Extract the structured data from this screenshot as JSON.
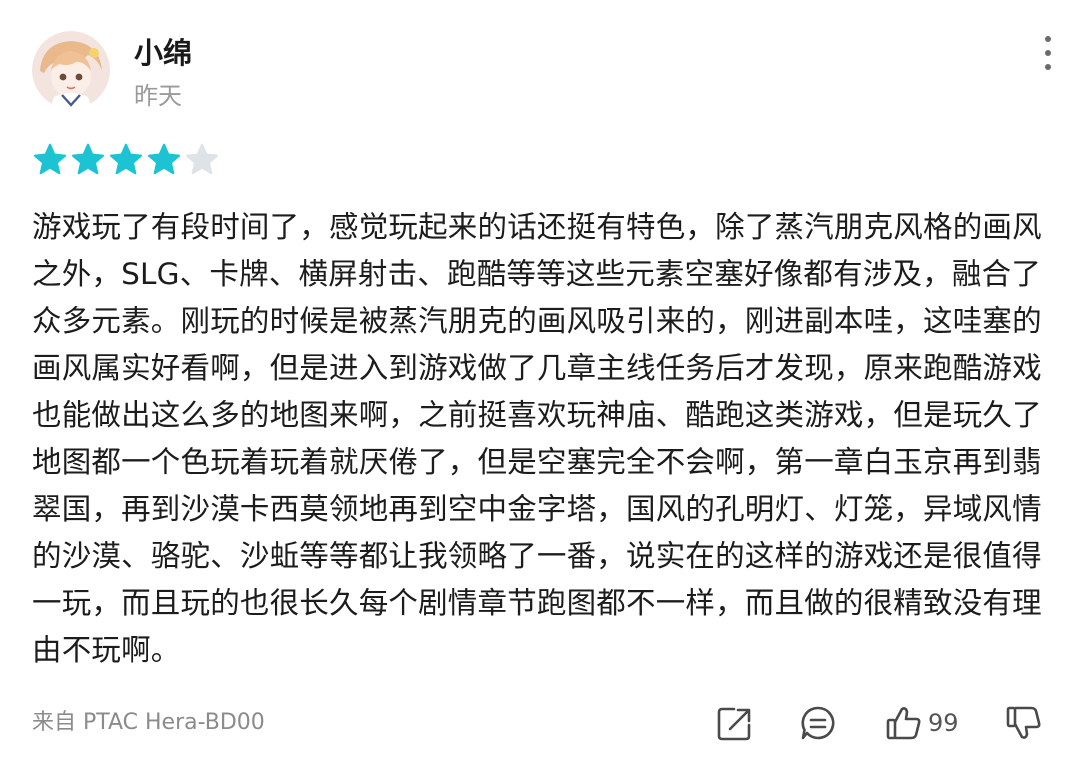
{
  "review": {
    "author": "小绵",
    "date": "昨天",
    "rating": 4,
    "max_rating": 5,
    "body": "游戏玩了有段时间了，感觉玩起来的话还挺有特色，除了蒸汽朋克风格的画风之外，SLG、卡牌、横屏射击、跑酷等等这些元素空塞好像都有涉及，融合了众多元素。刚玩的时候是被蒸汽朋克的画风吸引来的，刚进副本哇，这哇塞的画风属实好看啊，但是进入到游戏做了几章主线任务后才发现，原来跑酷游戏也能做出这么多的地图来啊，之前挺喜欢玩神庙、酷跑这类游戏，但是玩久了地图都一个色玩着玩着就厌倦了，但是空塞完全不会啊，第一章白玉京再到翡翠国，再到沙漠卡西莫领地再到空中金字塔，国风的孔明灯、灯笼，异域风情的沙漠、骆驼、沙蚯等等都让我领略了一番，说实在的这样的游戏还是很值得一玩，而且玩的也很长久每个剧情章节跑图都不一样，而且做的很精致没有理由不玩啊。",
    "device": "来自 PTAC Hera-BD00",
    "like_count": "99"
  },
  "icons": {
    "more": "more-vertical-icon",
    "star": "star-icon",
    "share": "share-icon",
    "comment": "comment-icon",
    "like": "thumbs-up-icon",
    "dislike": "thumbs-down-icon"
  },
  "colors": {
    "star_filled": "#1CC4D3",
    "star_empty": "#DDE3E6",
    "text": "#1C1C1C",
    "muted": "#9A9A9A"
  }
}
